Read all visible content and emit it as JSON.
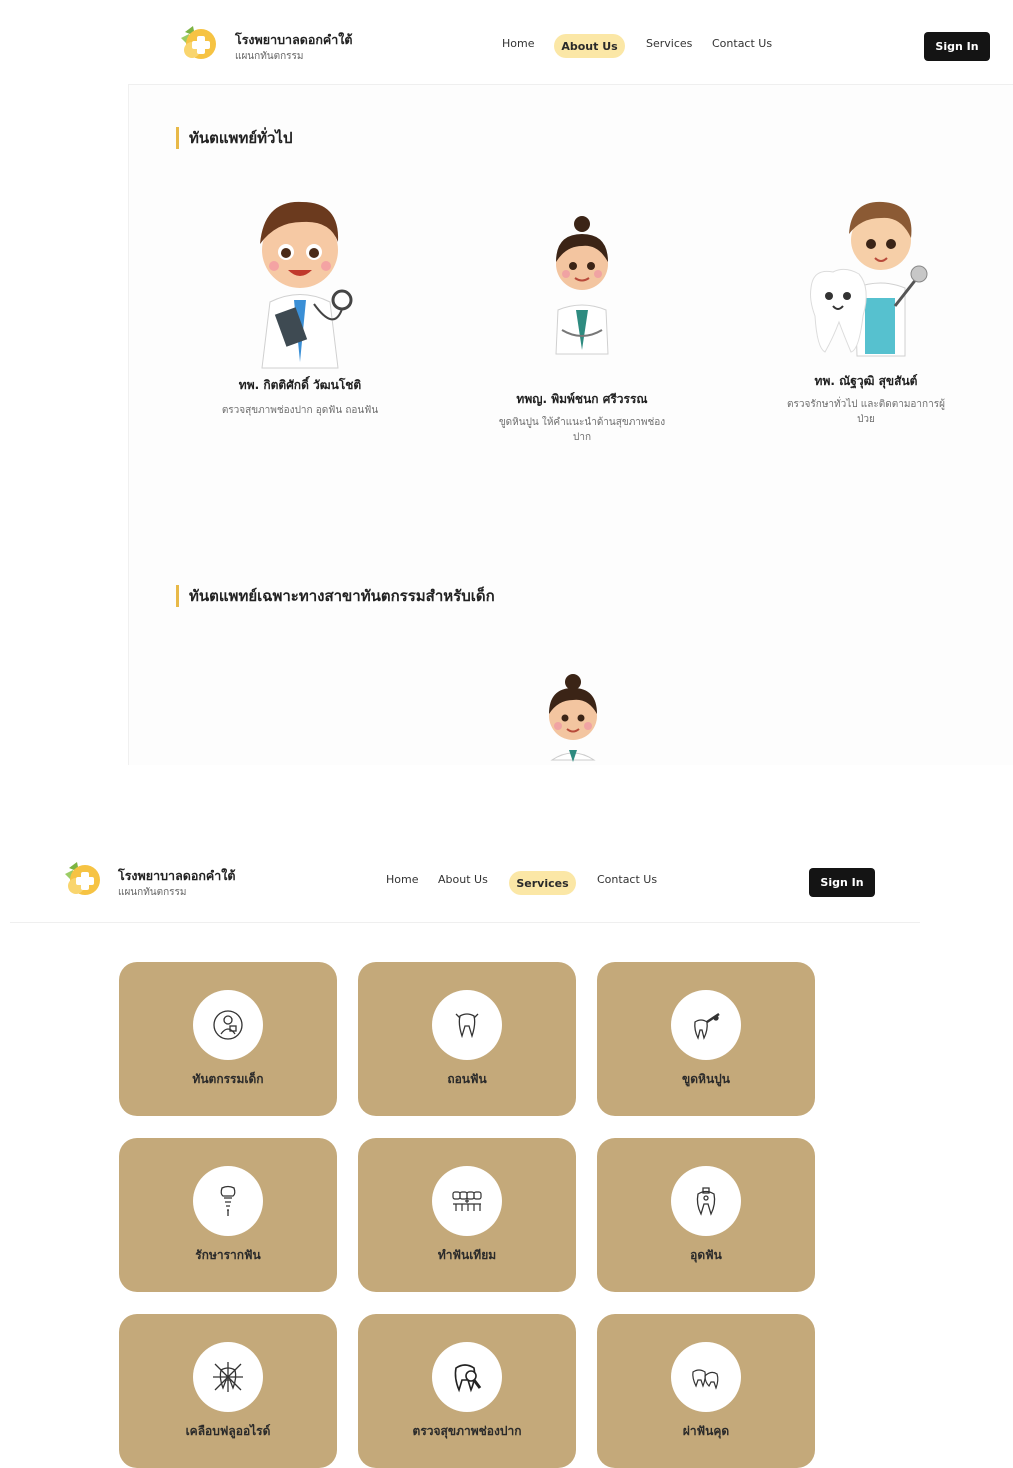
{
  "header": {
    "hospital_name": "โรงพยาบาลดอกคำใต้",
    "department": "แผนกทันตกรรม",
    "nav": [
      "Home",
      "About Us",
      "Services",
      "Contact Us"
    ],
    "sign_in_label": "Sign In"
  },
  "about_page": {
    "active_nav": "About Us",
    "general_section_title": "ทันตแพทย์ทั่วไป",
    "doctors": [
      {
        "name": "ทพ. กิตติศักดิ์ วัฒนโชติ",
        "desc": "ตรวจสุขภาพช่องปาก อุดฟัน ถอนฟัน"
      },
      {
        "name": "ทพญ. พิมพ์ชนก ศรีวรรณ",
        "desc": "ขูดหินปูน ให้คำแนะนำด้านสุขภาพช่องปาก"
      },
      {
        "name": "ทพ. ณัฐวุฒิ สุขสันต์",
        "desc": "ตรวจรักษาทั่วไป และติดตามอาการผู้ป่วย"
      }
    ],
    "pediatric_section_title": "ทันตแพทย์เฉพาะทางสาขาทันตกรรมสำหรับเด็ก"
  },
  "services_page": {
    "active_nav": "Services",
    "services": [
      {
        "label": "ทันตกรรมเด็ก",
        "icon": "child-dentist-icon"
      },
      {
        "label": "ถอนฟัน",
        "icon": "tooth-extraction-icon"
      },
      {
        "label": "ขูดหินปูน",
        "icon": "scaling-icon"
      },
      {
        "label": "รักษารากฟัน",
        "icon": "root-canal-icon"
      },
      {
        "label": "ทำฟันเทียม",
        "icon": "denture-icon"
      },
      {
        "label": "อุดฟัน",
        "icon": "tooth-filling-icon"
      },
      {
        "label": "เคลือบฟลูออไรด์",
        "icon": "fluoride-icon"
      },
      {
        "label": "ตรวจสุขภาพช่องปาก",
        "icon": "oral-exam-icon"
      },
      {
        "label": "ผ่าฟันคุด",
        "icon": "wisdom-tooth-icon"
      }
    ]
  },
  "colors": {
    "accent_pill": "#fbe7a6",
    "section_bar": "#e8b948",
    "service_card": "#c4a97a",
    "sign_in_bg": "#141414"
  }
}
